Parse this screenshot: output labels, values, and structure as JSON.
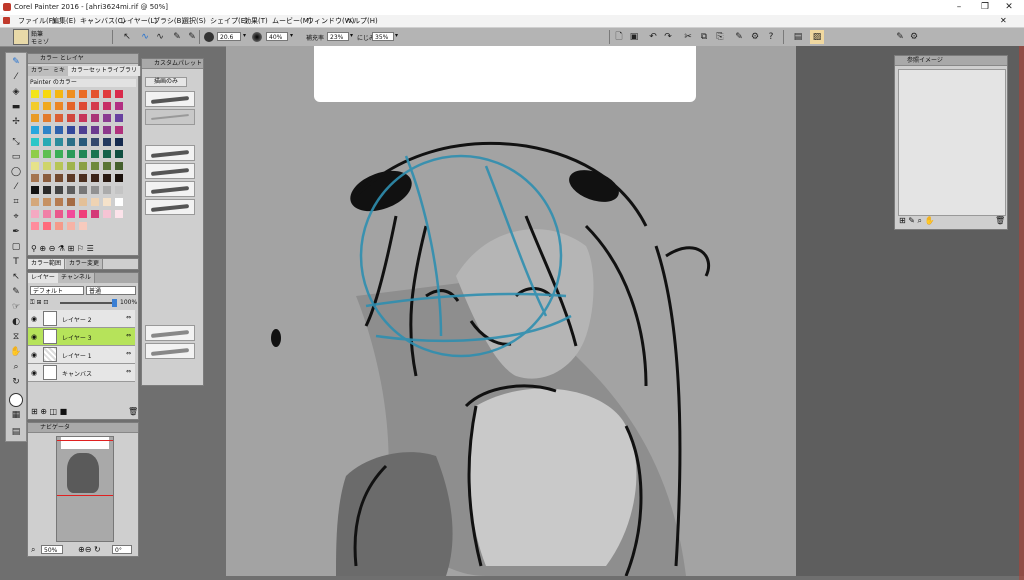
{
  "window": {
    "title": "Corel Painter 2016 - [ahri3624mi.rif @ 50%]",
    "minimize": "–",
    "maximize": "❐",
    "close": "✕",
    "doc_close": "✕"
  },
  "menu": [
    "ファイル(F)",
    "編集(E)",
    "キャンバス(C)",
    "レイヤー(L)",
    "ブラシ(B)",
    "選択(S)",
    "シェイプ(E)",
    "効果(T)",
    "ムービー(M)",
    "ウィンドウ(W)",
    "ヘルプ(H)"
  ],
  "propbar": {
    "brush_category": "鉛筆",
    "brush_variant": "モミゾ",
    "size_value": "20.6",
    "opacity_value": "40%",
    "resat_label": "補充率",
    "resat_value": "23%",
    "bleed_label": "にじみ",
    "bleed_value": "35%"
  },
  "color_panel": {
    "title": "カラー とレイヤ",
    "tabs": [
      "カラー",
      "ミキ",
      "カラーセットライブラリ"
    ],
    "set_name": "Painter のカラー",
    "swatches": [
      [
        "#f2e51a",
        "#f7d80f",
        "#f5b611",
        "#ef8e1e",
        "#ea6b24",
        "#e4512d",
        "#e03a3c",
        "#d92a4b"
      ],
      [
        "#f2cc2c",
        "#f0a91e",
        "#ec8624",
        "#e46429",
        "#de4a34",
        "#d53a4c",
        "#c72f66",
        "#b22f82"
      ],
      [
        "#e99b27",
        "#e27b2d",
        "#da5f35",
        "#d1473e",
        "#c6365b",
        "#a93577",
        "#8a3c91",
        "#6841a0"
      ],
      [
        "#28a7df",
        "#2d84c8",
        "#2f63ad",
        "#33489b",
        "#4d3f92",
        "#6b3a8f",
        "#8c378c",
        "#b1317c"
      ],
      [
        "#2cc7c8",
        "#27aab4",
        "#2b8c9c",
        "#2a6f87",
        "#285a7b",
        "#34486d",
        "#23395f",
        "#152a4e"
      ],
      [
        "#8fcd4a",
        "#5fbf51",
        "#3aae57",
        "#2a9a58",
        "#208755",
        "#1a7450",
        "#15614a",
        "#0f4e40"
      ],
      [
        "#e6e28a",
        "#cfd46a",
        "#b7c556",
        "#9fb44b",
        "#8aa043",
        "#6f8a3b",
        "#5a7535",
        "#45602e"
      ],
      [
        "#a47551",
        "#8a5d3e",
        "#734a30",
        "#5c3a26",
        "#4a2e1e",
        "#3a2317",
        "#2a1a12",
        "#1a100b"
      ],
      [
        "#111111",
        "#2a2a2a",
        "#444444",
        "#5d5d5d",
        "#777777",
        "#919191",
        "#ababab",
        "#c4c4c4"
      ],
      [
        "#d4a77a",
        "#c69163",
        "#b67b50",
        "#a46a43",
        "#e3c098",
        "#efd3b3",
        "#f5e2ca",
        "#ffffff"
      ],
      [
        "#f5a9c2",
        "#f07fa6",
        "#ea588c",
        "#f24a9a",
        "#ef3f7a",
        "#d43a78",
        "#f6c4d4",
        "#fce3ea"
      ],
      [
        "#ff8c9c",
        "#ff6b7c",
        "#f59a8a",
        "#f6b3a6",
        "#f7cabd",
        "",
        "",
        ""
      ]
    ]
  },
  "mixer_panel": {
    "tabs": [
      "カラー範囲",
      "カラー変更"
    ]
  },
  "layers_panel": {
    "tabs": [
      "レイヤー",
      "チャンネル"
    ],
    "composite_method": "デフォルト",
    "composite_depth": "普通",
    "opacity": "100%",
    "layers": [
      {
        "name": "レイヤー 2",
        "selected": false
      },
      {
        "name": "レイヤー 3",
        "selected": true
      },
      {
        "name": "レイヤー 1",
        "selected": false
      },
      {
        "name": "キャンバス",
        "selected": false
      }
    ]
  },
  "navigator": {
    "title": "ナビゲータ",
    "zoom": "50%",
    "rotation": "0°"
  },
  "custom_palette": {
    "title": "カスタムパレット",
    "button": "描画のみ"
  },
  "reference_panel": {
    "title": "参照イメージ"
  }
}
